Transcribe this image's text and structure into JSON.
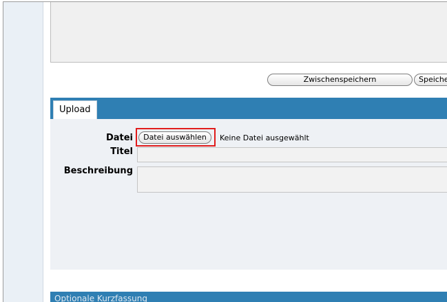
{
  "toolbar": {
    "zwischenspeichern_label": "Zwischenspeichern",
    "speichern_label": "Speichern"
  },
  "upload": {
    "tab_label": "Upload",
    "datei_label": "Datei",
    "file_button_label": "Datei auswählen",
    "no_file_text": "Keine Datei ausgewählt",
    "titel_label": "Titel",
    "beschreibung_label": "Beschreibung"
  },
  "optional_section": {
    "title": "Optionale Kurzfassung"
  },
  "colors": {
    "header_blue": "#2f7fb3",
    "highlight_red": "#e01b1b"
  }
}
